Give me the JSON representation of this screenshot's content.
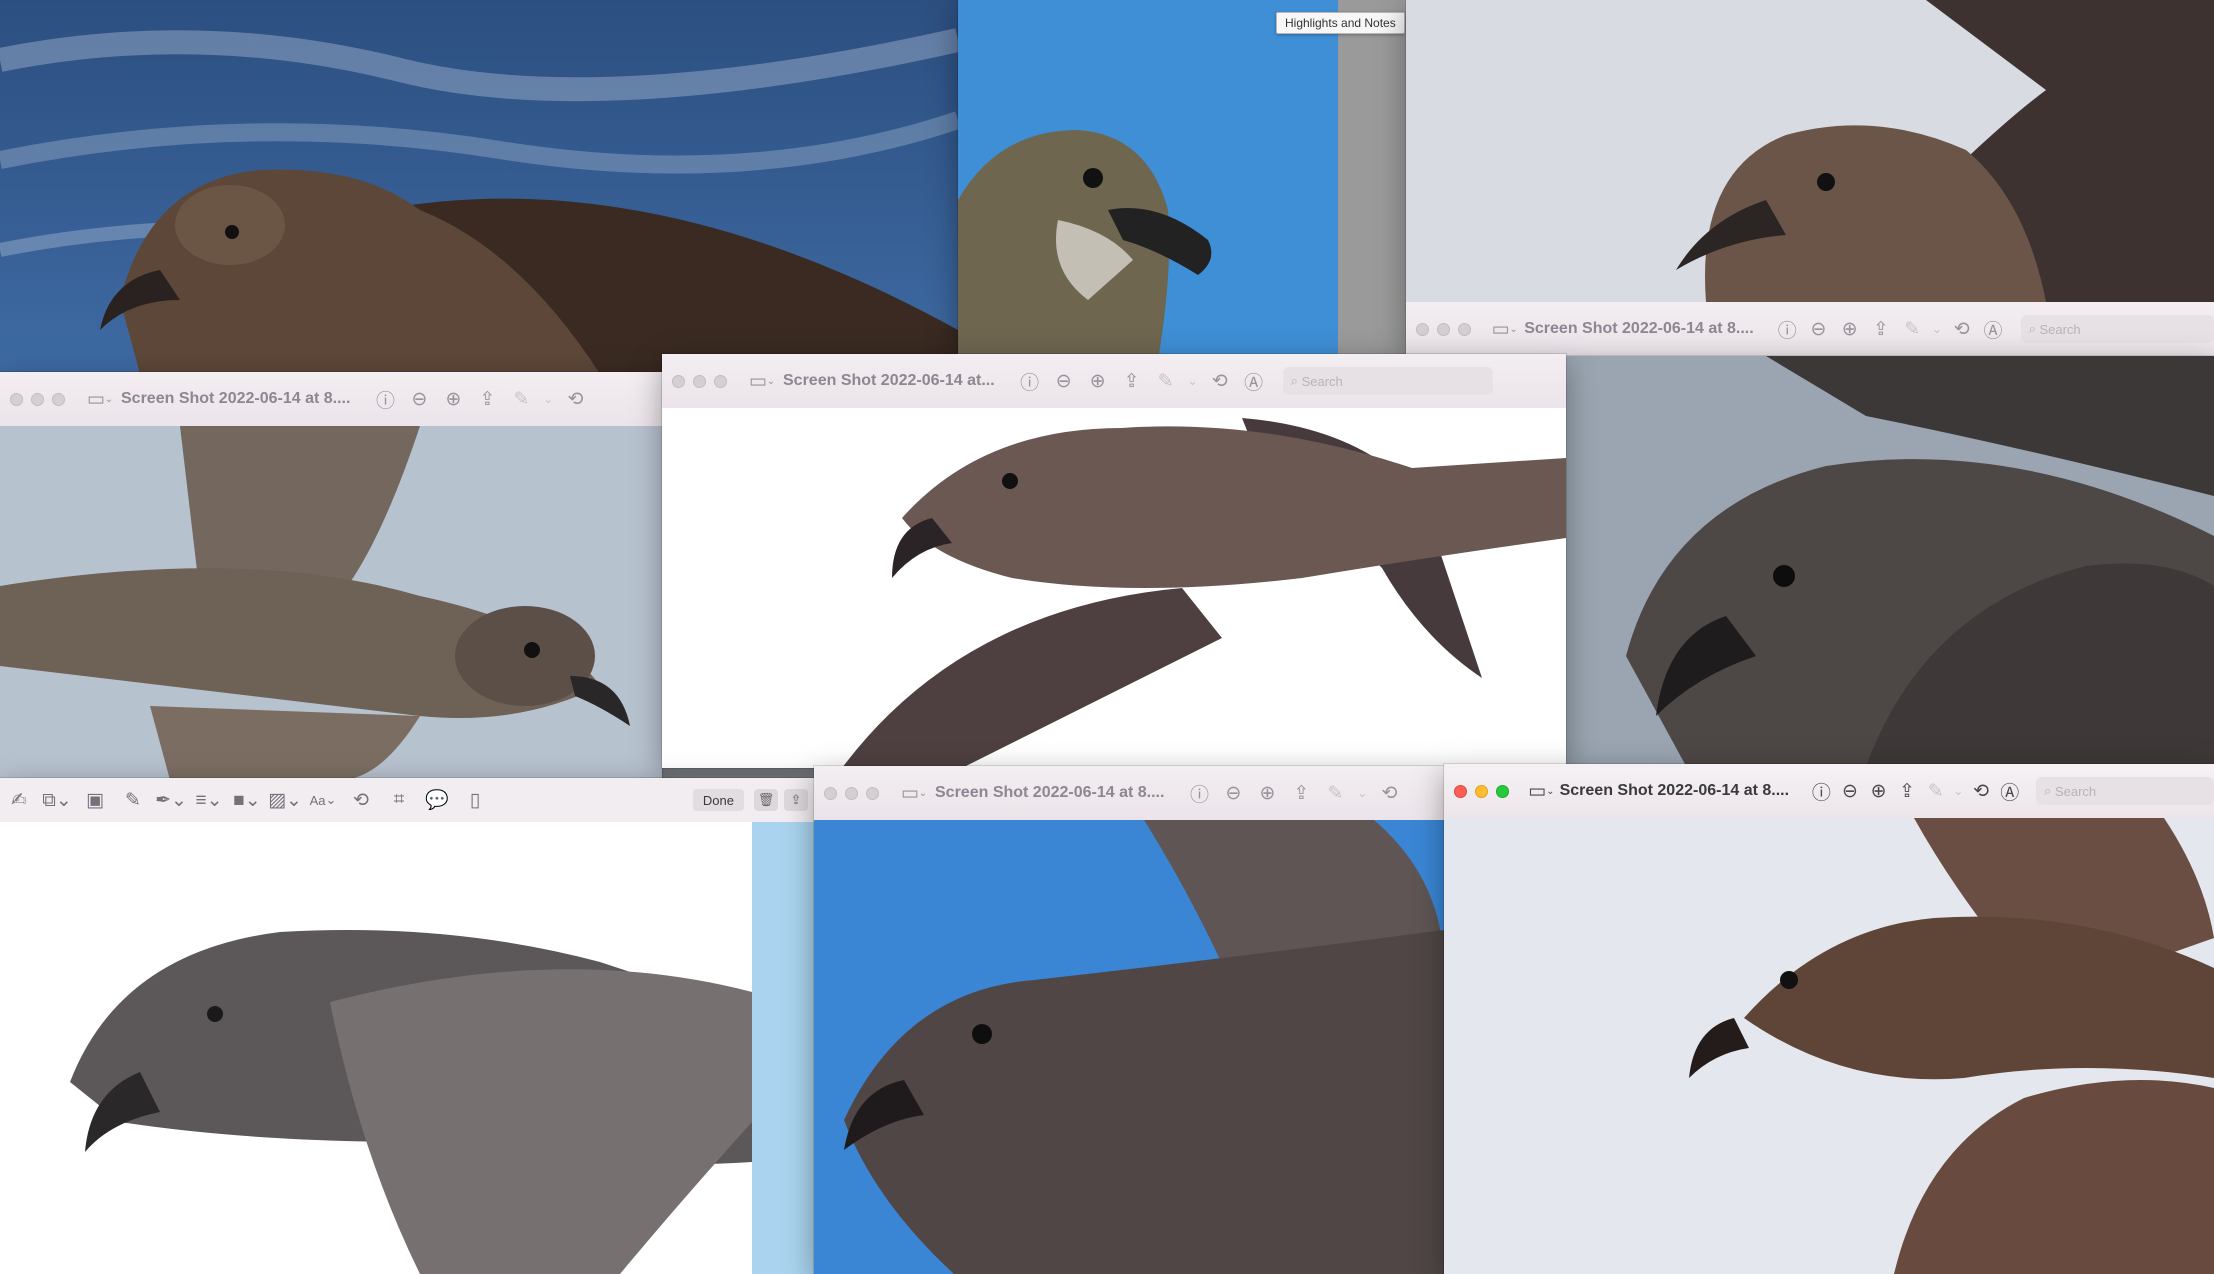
{
  "tooltip": "Highlights and Notes",
  "windows": {
    "top_right": {
      "title": "Screen Shot 2022-06-14 at 8....",
      "search": "Search"
    },
    "mid_left": {
      "title": "Screen Shot 2022-06-14 at 8...."
    },
    "center": {
      "title": "Screen Shot 2022-06-14 at...",
      "search": "Search"
    },
    "bottom_mid": {
      "title": "Screen Shot 2022-06-14 at 8...."
    },
    "bottom_right": {
      "title": "Screen Shot 2022-06-14 at 8....",
      "search": "Search"
    }
  },
  "markup_toolbar": {
    "done_label": "Done",
    "text_tool_label": "Aa"
  },
  "icons": [
    "sidebar-icon",
    "info-icon",
    "zoom-out-icon",
    "zoom-in-icon",
    "share-icon",
    "markup-pen-icon",
    "rotate-icon",
    "markup-circle-icon",
    "search-icon",
    "trash-icon",
    "crop-icon",
    "shapes-icon",
    "signature-icon"
  ],
  "colors": {
    "accent_close": "#fe5f57",
    "accent_minimize": "#febc2e",
    "accent_zoom": "#28c840"
  }
}
